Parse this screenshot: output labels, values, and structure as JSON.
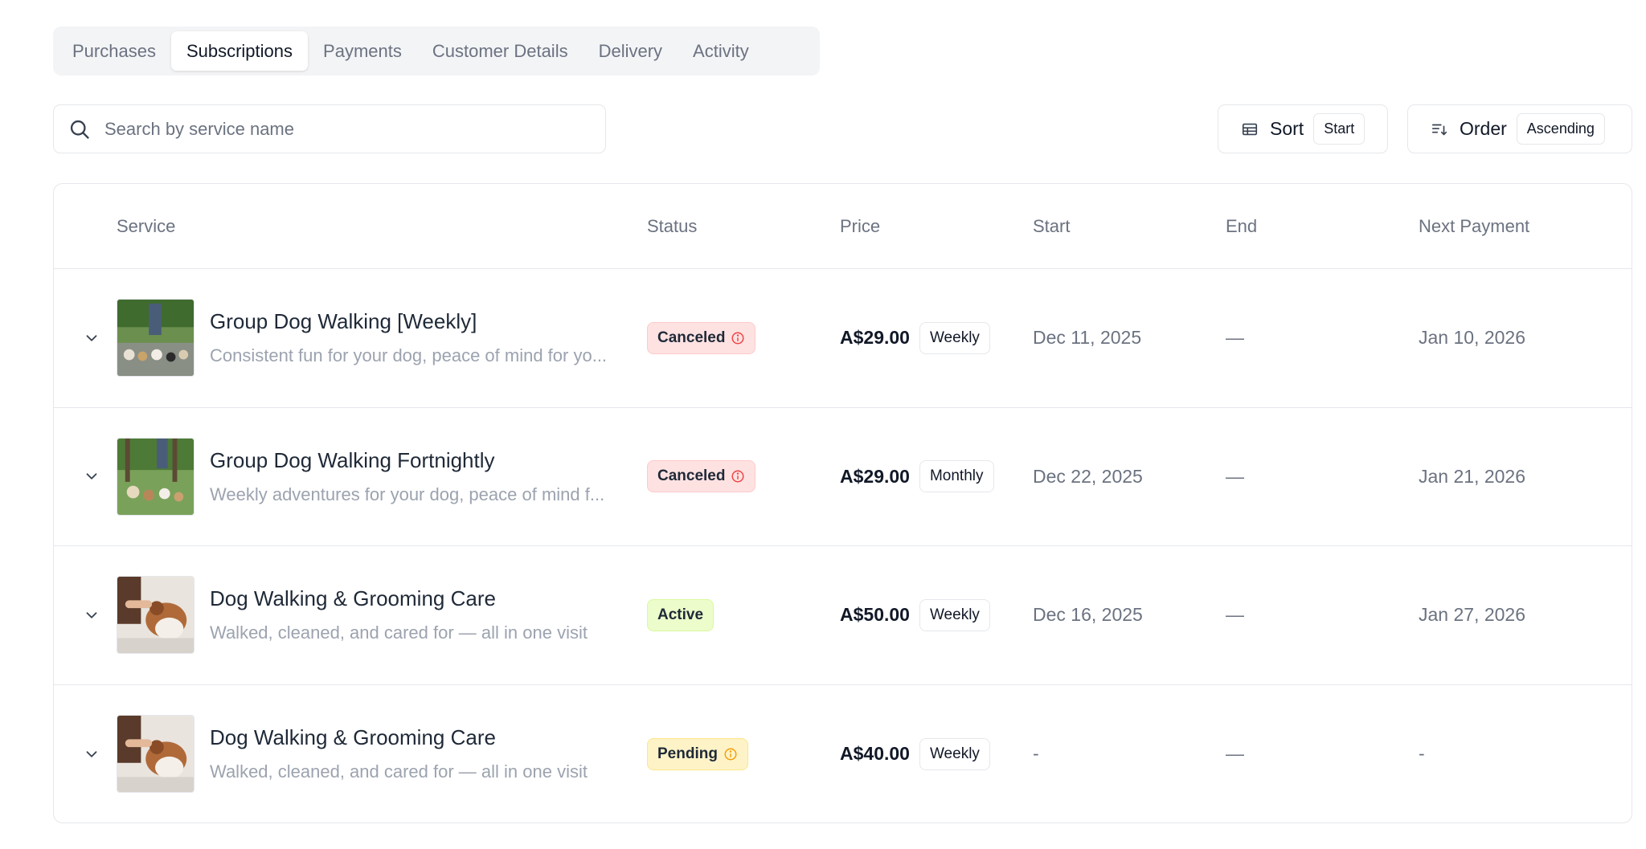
{
  "tabs": [
    {
      "label": "Purchases",
      "active": false
    },
    {
      "label": "Subscriptions",
      "active": true
    },
    {
      "label": "Payments",
      "active": false
    },
    {
      "label": "Customer Details",
      "active": false
    },
    {
      "label": "Delivery",
      "active": false
    },
    {
      "label": "Activity",
      "active": false
    }
  ],
  "search": {
    "placeholder": "Search by service name",
    "icon": "search-icon"
  },
  "sort": {
    "label": "Sort",
    "value": "Start",
    "icon": "table-icon"
  },
  "order": {
    "label": "Order",
    "value": "Ascending",
    "icon": "sort-descending-icon"
  },
  "table": {
    "columns": [
      "Service",
      "Status",
      "Price",
      "Start",
      "End",
      "Next Payment"
    ],
    "rows": [
      {
        "name": "Group Dog Walking [Weekly]",
        "description": "Consistent fun for your dog, peace of mind for yo...",
        "status": "Canceled",
        "price": "A$29.00",
        "frequency": "Weekly",
        "start": "Dec 11, 2025",
        "end": "—",
        "next_payment": "Jan 10, 2026"
      },
      {
        "name": "Group Dog Walking Fortnightly",
        "description": "Weekly adventures for your dog, peace of mind f...",
        "status": "Canceled",
        "price": "A$29.00",
        "frequency": "Monthly",
        "start": "Dec 22, 2025",
        "end": "—",
        "next_payment": "Jan 21, 2026"
      },
      {
        "name": "Dog Walking & Grooming Care",
        "description": "Walked, cleaned, and cared for — all in one visit",
        "status": "Active",
        "price": "A$50.00",
        "frequency": "Weekly",
        "start": "Dec 16, 2025",
        "end": "—",
        "next_payment": "Jan 27, 2026"
      },
      {
        "name": "Dog Walking & Grooming Care",
        "description": "Walked, cleaned, and cared for — all in one visit",
        "status": "Pending",
        "price": "A$40.00",
        "frequency": "Weekly",
        "start": "-",
        "end": "—",
        "next_payment": "-"
      }
    ]
  },
  "colors": {
    "canceled_icon": "#ef4444",
    "pending_icon": "#f59e0b",
    "border": "#e5e7eb"
  }
}
